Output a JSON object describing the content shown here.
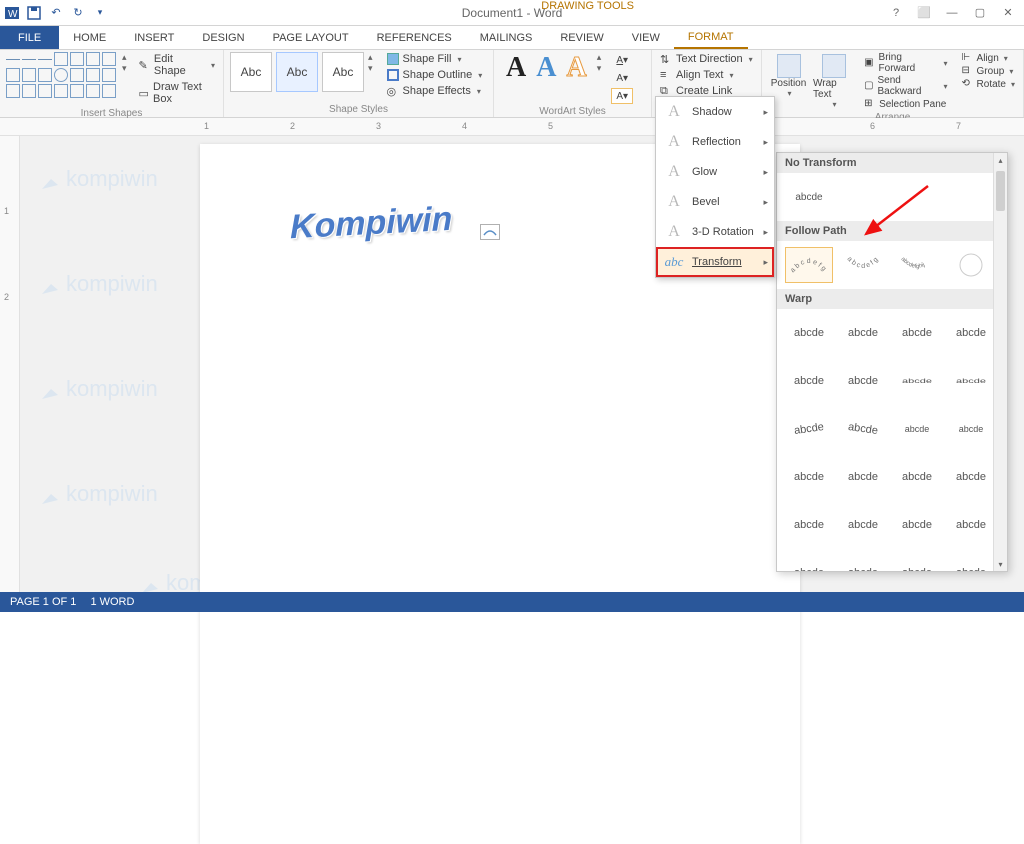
{
  "titlebar": {
    "title": "Document1 - Word",
    "drawing_tools": "DRAWING TOOLS"
  },
  "tabs": {
    "file": "FILE",
    "home": "HOME",
    "insert": "INSERT",
    "design": "DESIGN",
    "page_layout": "PAGE LAYOUT",
    "references": "REFERENCES",
    "mailings": "MAILINGS",
    "review": "REVIEW",
    "view": "VIEW",
    "format": "FORMAT"
  },
  "ribbon": {
    "insert_shapes": {
      "label": "Insert Shapes",
      "edit_shape": "Edit Shape",
      "draw_text_box": "Draw Text Box"
    },
    "shape_styles": {
      "label": "Shape Styles",
      "box1": "Abc",
      "box2": "Abc",
      "box3": "Abc",
      "shape_fill": "Shape Fill",
      "shape_outline": "Shape Outline",
      "shape_effects": "Shape Effects"
    },
    "wordart_styles": {
      "label": "WordArt Styles",
      "a": "A"
    },
    "text": {
      "text_direction": "Text Direction",
      "align_text": "Align Text",
      "create_link": "Create Link"
    },
    "arrange": {
      "label": "Arrange",
      "position": "Position",
      "wrap_text": "Wrap Text",
      "bring_forward": "Bring Forward",
      "send_backward": "Send Backward",
      "selection_pane": "Selection Pane",
      "align": "Align",
      "group": "Group",
      "rotate": "Rotate"
    }
  },
  "document": {
    "wordart_text": "Kompiwin"
  },
  "fx_menu": {
    "shadow": "Shadow",
    "reflection": "Reflection",
    "glow": "Glow",
    "bevel": "Bevel",
    "rotation3d": "3-D Rotation",
    "transform": "Transform"
  },
  "transform_gallery": {
    "no_transform": "No Transform",
    "no_transform_sample": "abcde",
    "follow_path": "Follow Path",
    "warp": "Warp",
    "sample": "abcde"
  },
  "statusbar": {
    "page": "PAGE 1 OF 1",
    "words": "1 WORD"
  },
  "watermark": "kompiwin",
  "ruler_marks_h": [
    "1",
    "2",
    "3",
    "4",
    "5",
    "6",
    "7"
  ],
  "ruler_marks_v": [
    "1",
    "2"
  ]
}
